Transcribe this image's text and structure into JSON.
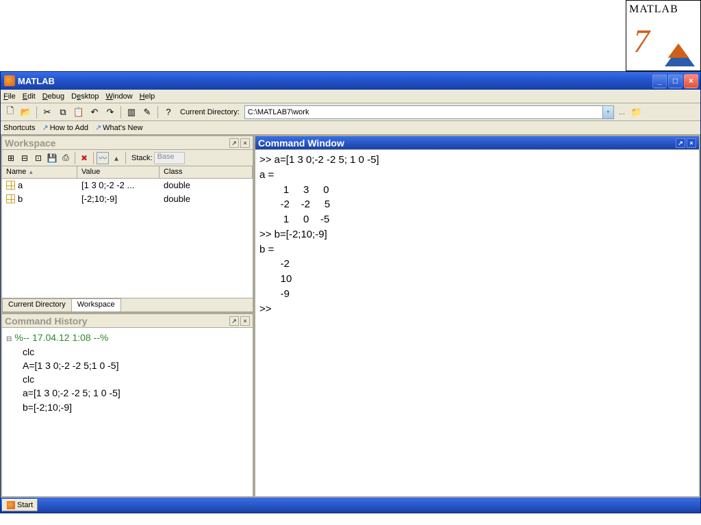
{
  "logo": {
    "brand": "MATLAB",
    "version": "7"
  },
  "titlebar": {
    "title": "MATLAB"
  },
  "menu": {
    "file": "File",
    "edit": "Edit",
    "debug": "Debug",
    "desktop": "Desktop",
    "window": "Window",
    "help": "Help"
  },
  "toolbar": {
    "current_dir_label": "Current Directory:",
    "current_dir_value": "C:\\MATLAB7\\work",
    "ellipsis": "..."
  },
  "shortcuts": {
    "label": "Shortcuts",
    "howto": "How to Add",
    "whatsnew": "What's New"
  },
  "workspace": {
    "title": "Workspace",
    "stack_label": "Stack:",
    "stack_value": "Base",
    "columns": {
      "name": "Name",
      "value": "Value",
      "class": "Class"
    },
    "rows": [
      {
        "name": "a",
        "value": "[1 3 0;-2 -2 ...",
        "class": "double"
      },
      {
        "name": "b",
        "value": "[-2;10;-9]",
        "class": "double"
      }
    ],
    "tabs": {
      "curdir": "Current Directory",
      "workspace": "Workspace"
    }
  },
  "history": {
    "title": "Command History",
    "timestamp": "%-- 17.04.12 1:08 --%",
    "lines": [
      "clc",
      "A=[1 3 0;-2 -2 5;1 0 -5]",
      "clc",
      "a=[1 3 0;-2 -2 5; 1 0 -5]",
      "b=[-2;10;-9]"
    ]
  },
  "command_window": {
    "title": "Command Window",
    "lines": [
      ">> a=[1 3 0;-2 -2 5; 1 0 -5]",
      "",
      "a =",
      "",
      "     1     3     0",
      "    -2    -2     5",
      "     1     0    -5",
      "",
      ">> b=[-2;10;-9]",
      "",
      "b =",
      "",
      "    -2",
      "    10",
      "    -9",
      "",
      ">> "
    ]
  },
  "start": {
    "label": "Start"
  },
  "icons": {
    "new": "🗋",
    "open": "📂",
    "cut": "✂",
    "copy": "⧉",
    "paste": "📋",
    "undo": "↶",
    "redo": "↷",
    "simulink": "▥",
    "guide": "✎",
    "help": "?",
    "folder_up": "📁",
    "undock": "↗",
    "close": "×",
    "plot": "〰",
    "print": "⎙",
    "delete": "✖",
    "grid_new": "⊞",
    "grid_open": "⊟",
    "grid_import": "⊡",
    "grid_save": "💾"
  }
}
